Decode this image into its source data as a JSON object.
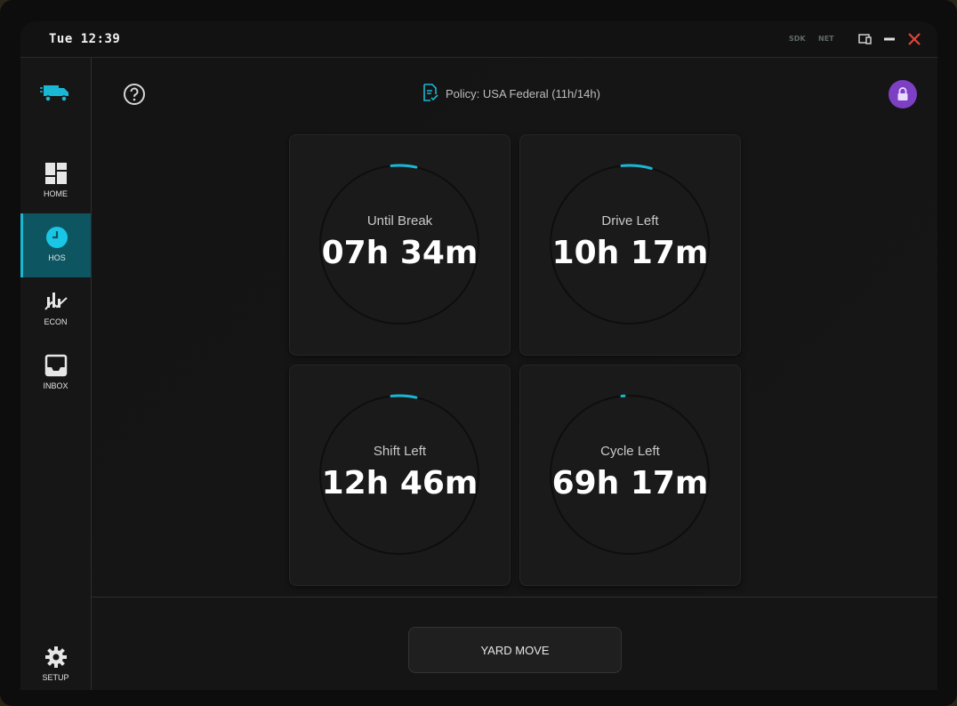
{
  "titlebar": {
    "clock": "Tue 12:39",
    "tags": [
      "SDK",
      "NET"
    ]
  },
  "sidebar": {
    "items": [
      {
        "label": "HOME",
        "icon": "dashboard-icon",
        "active": false
      },
      {
        "label": "HOS",
        "icon": "clock-icon",
        "active": true
      },
      {
        "label": "ECON",
        "icon": "chart-icon",
        "active": false
      },
      {
        "label": "INBOX",
        "icon": "inbox-icon",
        "active": false
      }
    ],
    "setup_label": "SETUP"
  },
  "header": {
    "policy": "Policy: USA Federal (11h/14h)"
  },
  "timers": [
    {
      "label": "Until Break",
      "value": "07h 34m",
      "progress": 0.05
    },
    {
      "label": "Drive Left",
      "value": "10h 17m",
      "progress": 0.06
    },
    {
      "label": "Shift Left",
      "value": "12h 46m",
      "progress": 0.05
    },
    {
      "label": "Cycle Left",
      "value": "69h 17m",
      "progress": 0.005
    }
  ],
  "actions": {
    "yard_move": "YARD MOVE"
  },
  "colors": {
    "accent": "#19b7d4",
    "lock": "#7d3fc4",
    "close": "#e0443a"
  }
}
